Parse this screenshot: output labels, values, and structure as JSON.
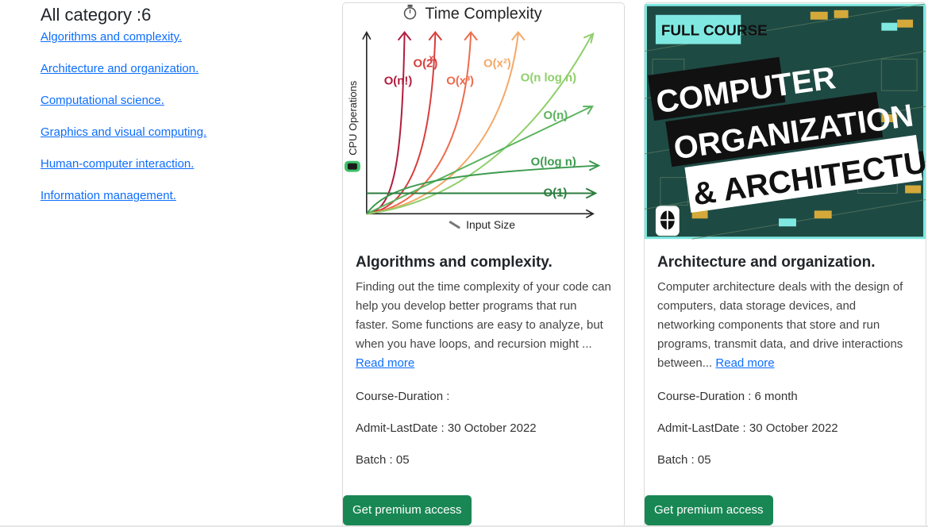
{
  "sidebar": {
    "heading": "All category :6",
    "categories": [
      "Algorithms and complexity.",
      "Architecture and organization.",
      "Computational science.",
      "Graphics and visual computing.",
      "Human-computer interaction.",
      "Information management."
    ]
  },
  "cards": [
    {
      "image": {
        "title": "Time Complexity",
        "ylabel": "CPU Operations",
        "xlabel": "Input Size",
        "curves": [
          "O(n!)",
          "O(2^x)",
          "O(x³)",
          "O(x²)",
          "O(n log n)",
          "O(n)",
          "O(log n)",
          "O(1)"
        ],
        "curve_labels": {
          "nfact": "O(n!)",
          "two_base": "O(2",
          "two_exp": "x",
          "x3": "O(x³)",
          "x2": "O(x²)",
          "nlogn": "O(n log n)",
          "n": "O(n)",
          "logn": "O(log n)",
          "one": "O(1)"
        }
      },
      "title": "Algorithms and complexity.",
      "description": "Finding out the time complexity of your code can help you develop better programs that run faster. Some functions are easy to analyze, but when you have loops, and recursion might ...",
      "read_more": "Read more",
      "duration": "Course-Duration :",
      "admit_last_date": "Admit-LastDate : 30 October 2022",
      "batch": "Batch : 05",
      "button": "Get premium access"
    },
    {
      "image": {
        "badge": "FULL COURSE",
        "line1": "COMPUTER",
        "line2": "ORGANIZATION",
        "line3": "& ARCHITECTURE",
        "bg_color": "#1e4a44",
        "accent": "#7fe9e1"
      },
      "title": "Architecture and organization.",
      "description": "Computer architecture deals with the design of computers, data storage devices, and networking components that store and run programs, transmit data, and drive interactions between...",
      "read_more": "Read more",
      "duration": "Course-Duration : 6 month",
      "admit_last_date": "Admit-LastDate : 30 October 2022",
      "batch": "Batch : 05",
      "button": "Get premium access"
    }
  ],
  "colors": {
    "link": "#0d6efd",
    "button": "#198754",
    "text": "#212529"
  }
}
